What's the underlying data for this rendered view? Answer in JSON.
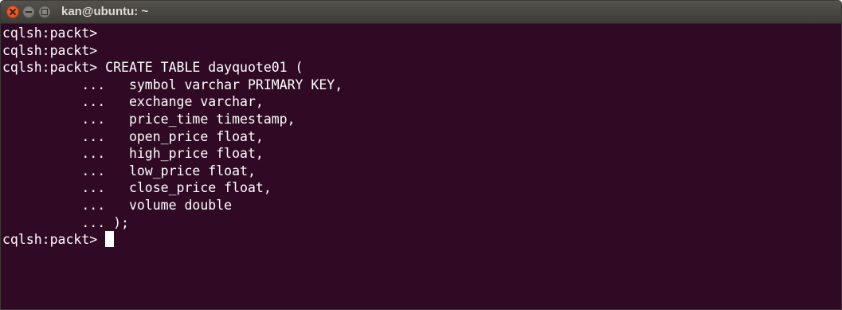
{
  "window": {
    "title": "kan@ubuntu: ~"
  },
  "terminal": {
    "lines": [
      "cqlsh:packt>",
      "cqlsh:packt>",
      "cqlsh:packt> CREATE TABLE dayquote01 (",
      "          ...   symbol varchar PRIMARY KEY,",
      "          ...   exchange varchar,",
      "          ...   price_time timestamp,",
      "          ...   open_price float,",
      "          ...   high_price float,",
      "          ...   low_price float,",
      "          ...   close_price float,",
      "          ...   volume double",
      "          ... );",
      "cqlsh:packt> "
    ]
  },
  "colors": {
    "background": "#300a24",
    "text": "#ffffff",
    "close_button": "#e95420",
    "titlebar": "#3d3c37"
  }
}
